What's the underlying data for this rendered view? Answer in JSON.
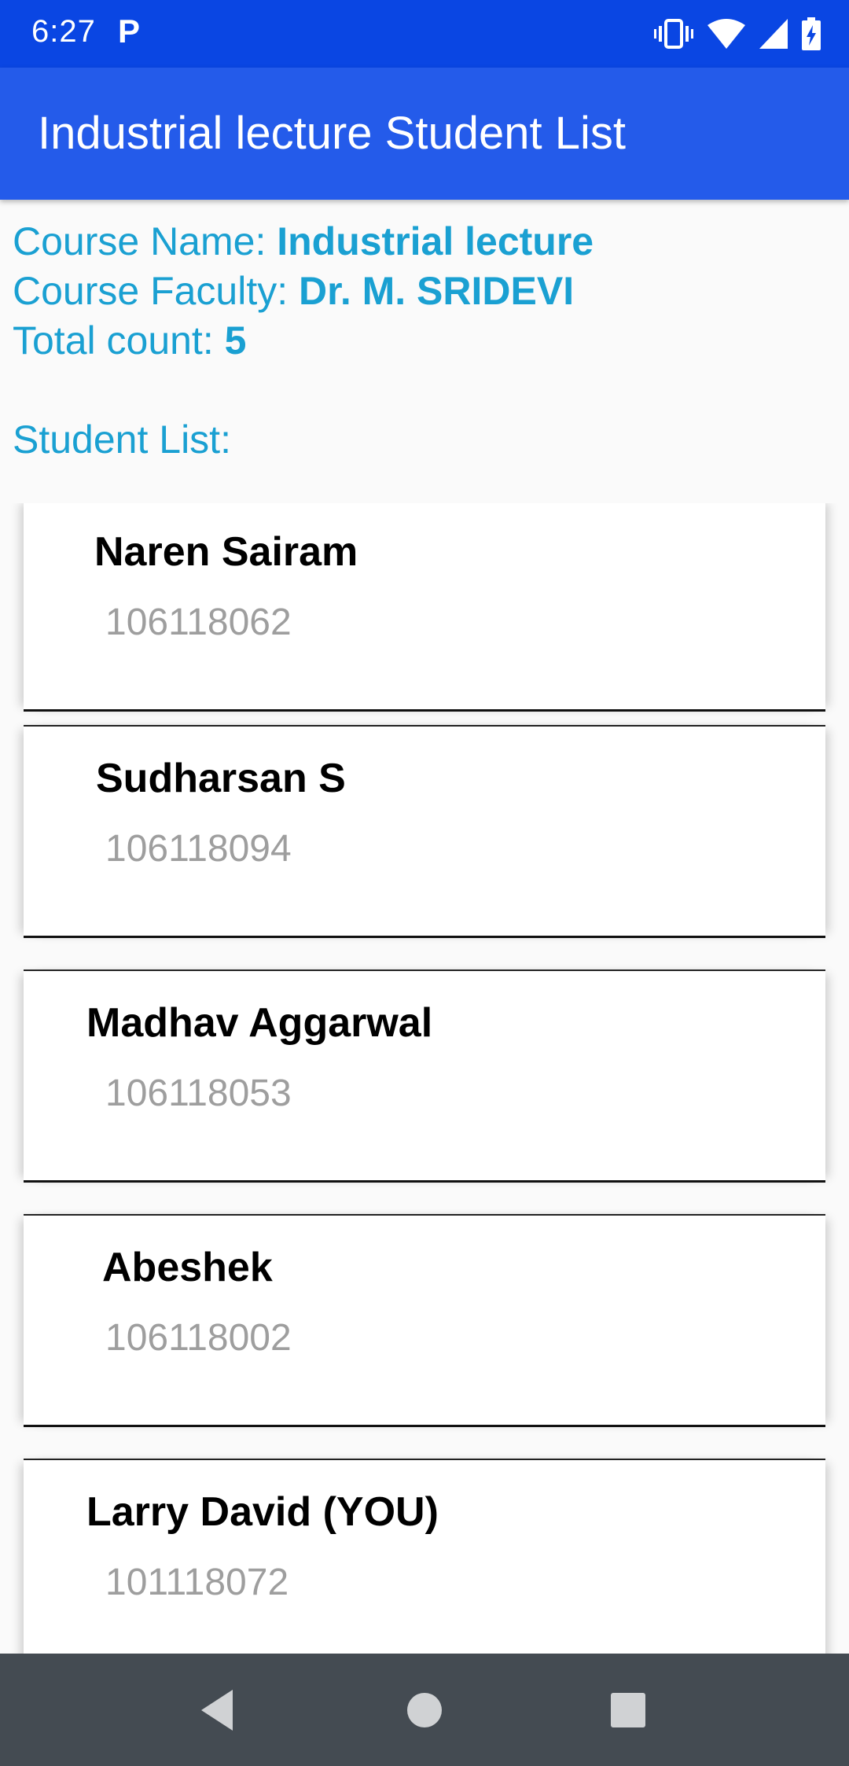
{
  "status_bar": {
    "time": "6:27",
    "notification_icon": "P",
    "icons": [
      "vibrate-icon",
      "wifi-icon",
      "signal-icon",
      "battery-charging-icon"
    ]
  },
  "app_bar": {
    "title": "Industrial lecture Student List",
    "color": "#245bea"
  },
  "course": {
    "name_label": "Course Name: ",
    "name_value": "Industrial lecture",
    "faculty_label": "Course Faculty: ",
    "faculty_value": "Dr. M. SRIDEVI",
    "count_label": "Total count: ",
    "count_value": "5",
    "list_label": "Student List:",
    "accent_color": "#1aa0d2"
  },
  "students": [
    {
      "name": "Naren Sairam",
      "id": "106118062"
    },
    {
      "name": "Sudharsan S",
      "id": "106118094"
    },
    {
      "name": "Madhav Aggarwal",
      "id": "106118053"
    },
    {
      "name": "Abeshek",
      "id": "106118002"
    },
    {
      "name": "Larry David (YOU)",
      "id": "101118072"
    }
  ],
  "nav_bar": {
    "buttons": [
      "back-icon",
      "home-icon",
      "recents-icon"
    ]
  }
}
